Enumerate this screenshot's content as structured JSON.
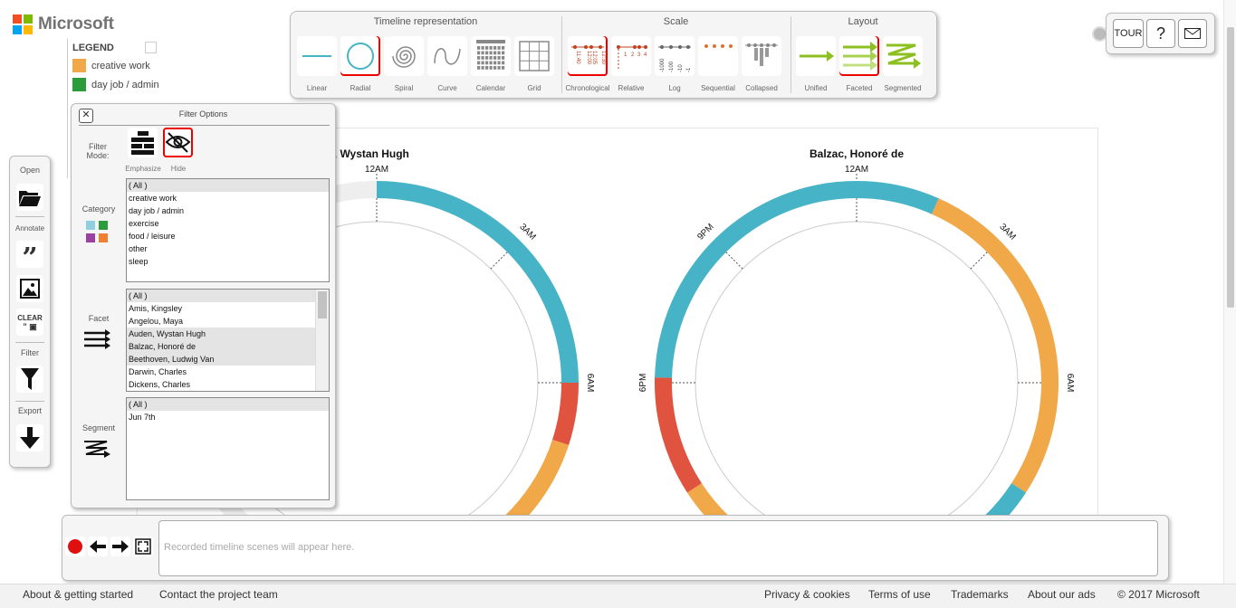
{
  "brand": {
    "name": "Microsoft",
    "logo_colors": [
      "#f25022",
      "#7fba00",
      "#00a4ef",
      "#ffb900"
    ]
  },
  "legend": {
    "title": "LEGEND",
    "items": [
      {
        "label": "creative work",
        "color": "#f0a848"
      },
      {
        "label": "day job / admin",
        "color": "#2a9d3a"
      }
    ]
  },
  "toolbar": {
    "representation": {
      "title": "Timeline representation",
      "options": [
        "Linear",
        "Radial",
        "Spiral",
        "Curve",
        "Calendar",
        "Grid"
      ],
      "selected": "Radial"
    },
    "scale": {
      "title": "Scale",
      "options": [
        "Chronological",
        "Relative",
        "Log",
        "Sequential",
        "Collapsed"
      ],
      "selected": "Chronological",
      "chron_ticks": [
        "11:40",
        "12:00",
        "12:05",
        "12:30"
      ],
      "rel_ticks": [
        "1",
        "2",
        "3",
        "4"
      ],
      "log_ticks": [
        "-1000",
        "-100",
        "-10",
        "-1"
      ]
    },
    "layout": {
      "title": "Layout",
      "options": [
        "Unified",
        "Faceted",
        "Segmented"
      ],
      "selected": "Faceted"
    }
  },
  "topright": {
    "tour": "TOUR",
    "help": "?",
    "feedback_icon": "mail-icon"
  },
  "lefttoolbar": {
    "open_label": "Open",
    "annotate_label": "Annotate",
    "clear_label": "CLEAR",
    "filter_label": "Filter",
    "export_label": "Export"
  },
  "filter": {
    "title": "Filter Options",
    "mode_label": "Filter Mode:",
    "modes": [
      "Emphasize",
      "Hide"
    ],
    "selected_mode": "Hide",
    "category_label": "Category",
    "categories": [
      "( All )",
      "creative work",
      "day job / admin",
      "exercise",
      "food / leisure",
      "other",
      "sleep"
    ],
    "facet_label": "Facet",
    "facets": [
      "( All )",
      "Amis, Kingsley",
      "Angelou, Maya",
      "Auden, Wystan Hugh",
      "Balzac, Honoré de",
      "Beethoven, Ludwig Van",
      "Darwin, Charles",
      "Dickens, Charles"
    ],
    "facets_selected": [
      "Auden, Wystan Hugh",
      "Balzac, Honoré de",
      "Beethoven, Ludwig Van"
    ],
    "segment_label": "Segment",
    "segments": [
      "( All )",
      "Jun 7th"
    ]
  },
  "charts": [
    {
      "title": "Auden, Wystan Hugh",
      "shown_title": "uden, Wystan Hugh",
      "labels": [
        "12AM",
        "3AM",
        "6AM"
      ],
      "segments_hours": [
        {
          "start": 0,
          "end": 6,
          "category": "sleep",
          "color": "#46b4c6"
        },
        {
          "start": 6,
          "end": 7.2,
          "category": "exercise",
          "color": "#e0533e"
        },
        {
          "start": 7.2,
          "end": 10.5,
          "category": "creative work",
          "color": "#f0a848"
        }
      ]
    },
    {
      "title": "Balzac, Honoré de",
      "labels": [
        "12AM",
        "3AM",
        "6AM",
        "6PM",
        "9PM"
      ],
      "segments_hours": [
        {
          "start": 0,
          "end": 1.6,
          "category": "sleep",
          "color": "#46b4c6"
        },
        {
          "start": 1.6,
          "end": 8.2,
          "category": "creative work",
          "color": "#f0a848"
        },
        {
          "start": 8.2,
          "end": 9.6,
          "category": "sleep",
          "color": "#46b4c6"
        },
        {
          "start": 14.4,
          "end": 15.8,
          "category": "creative work",
          "color": "#f0a848"
        },
        {
          "start": 15.8,
          "end": 18.1,
          "category": "exercise",
          "color": "#e0533e"
        },
        {
          "start": 18.1,
          "end": 24,
          "category": "sleep",
          "color": "#46b4c6"
        }
      ]
    }
  ],
  "recorder": {
    "placeholder": "Recorded timeline scenes will appear here."
  },
  "footer": {
    "left": [
      "About & getting started",
      "Contact the project team"
    ],
    "right": [
      "Privacy & cookies",
      "Terms of use",
      "Trademarks",
      "About our ads",
      "© 2017 Microsoft"
    ]
  }
}
